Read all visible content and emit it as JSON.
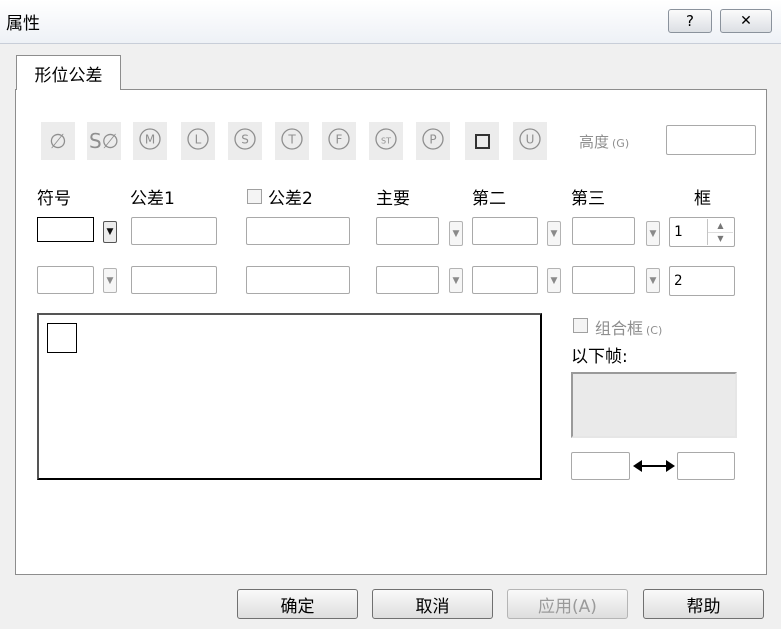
{
  "window": {
    "title": "属性",
    "help_glyph": "?",
    "close_glyph": "✕"
  },
  "tabs": [
    {
      "label": "形位公差"
    }
  ],
  "symbols": [
    {
      "name": "diameter-icon",
      "glyph": "∅"
    },
    {
      "name": "spherical-diameter-icon",
      "glyph": "S∅"
    },
    {
      "name": "circle-m-icon",
      "glyph": "M"
    },
    {
      "name": "circle-l-icon",
      "glyph": "L"
    },
    {
      "name": "circle-s-icon",
      "glyph": "S"
    },
    {
      "name": "circle-t-icon",
      "glyph": "T"
    },
    {
      "name": "circle-f-icon",
      "glyph": "F"
    },
    {
      "name": "circle-st-icon",
      "glyph": "ST"
    },
    {
      "name": "circle-p-icon",
      "glyph": "P"
    },
    {
      "name": "square-icon",
      "glyph": "□"
    },
    {
      "name": "circle-u-icon",
      "glyph": "U"
    }
  ],
  "height": {
    "label": "高度",
    "accel": "(G)",
    "value": ""
  },
  "columns": {
    "symbol": "符号",
    "tolerance1": "公差1",
    "tolerance2": "公差2",
    "primary": "主要",
    "second": "第二",
    "third": "第三",
    "frame": "框"
  },
  "rows": [
    {
      "frame": "1"
    },
    {
      "frame": "2"
    }
  ],
  "composite_frame": {
    "label": "组合框",
    "accel": "(C)",
    "checked": false
  },
  "following_frame_label": "以下帧:",
  "buttons": {
    "ok": "确定",
    "cancel": "取消",
    "apply": "应用(A)",
    "help": "帮助"
  }
}
